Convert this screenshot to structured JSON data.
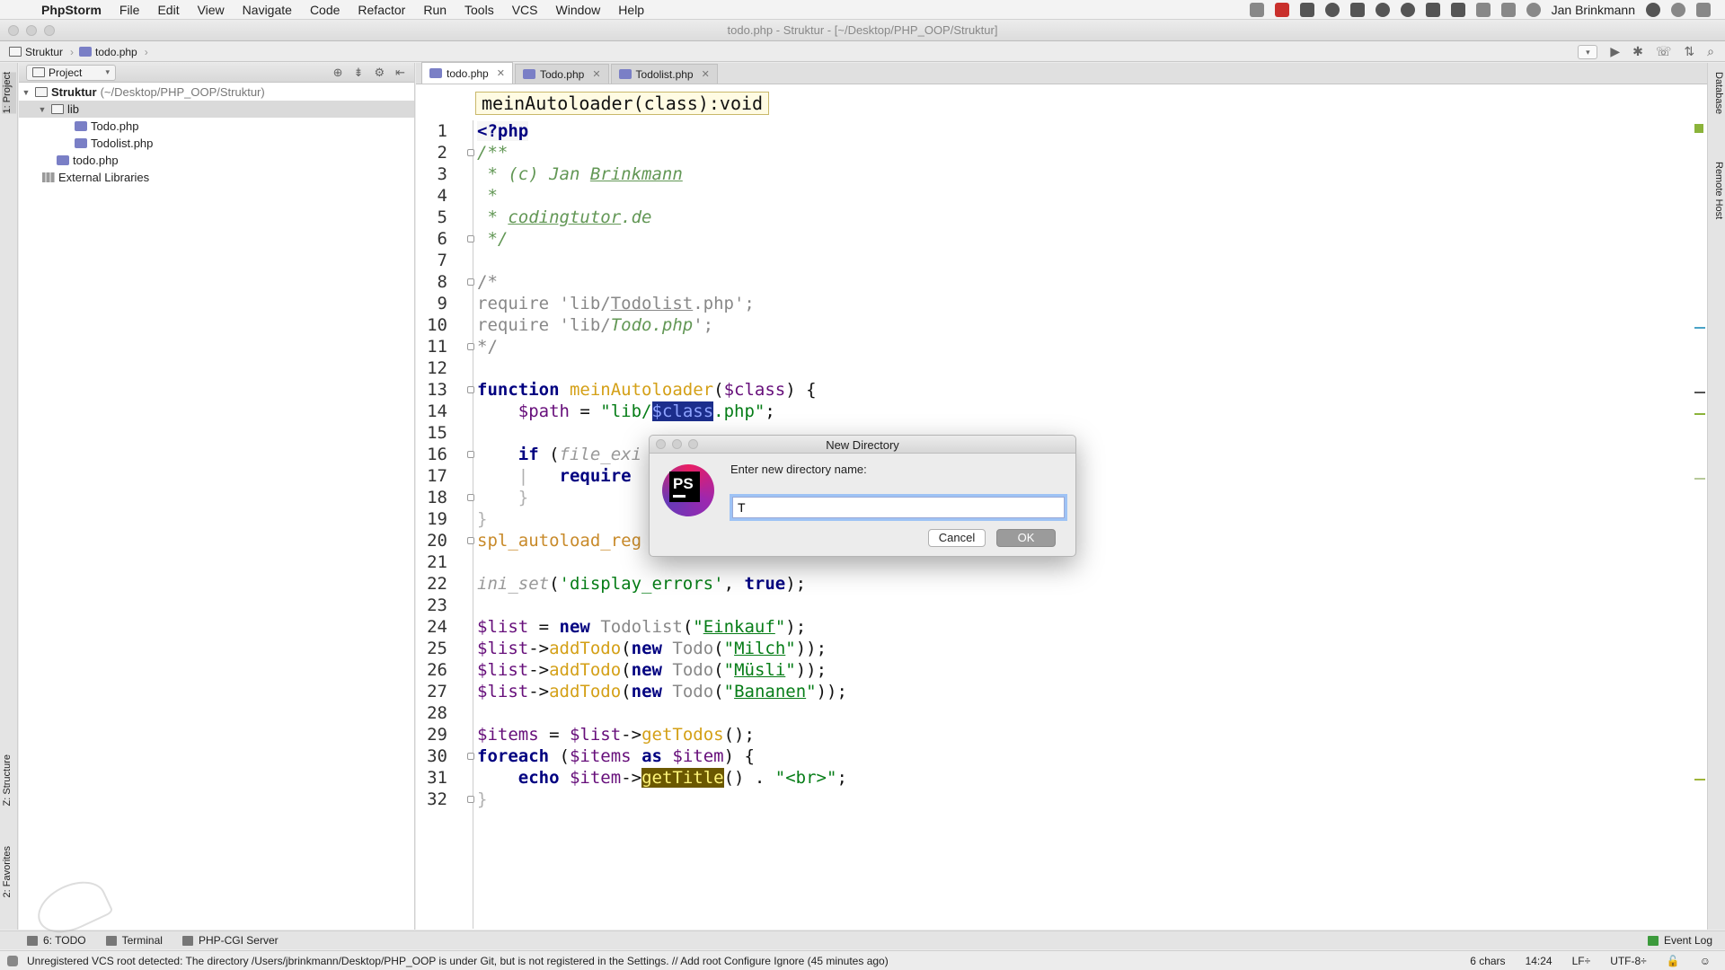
{
  "menubar": {
    "app_name": "PhpStorm",
    "items": [
      "File",
      "Edit",
      "View",
      "Navigate",
      "Code",
      "Refactor",
      "Run",
      "Tools",
      "VCS",
      "Window",
      "Help"
    ],
    "user": "Jan Brinkmann"
  },
  "window": {
    "title": "todo.php - Struktur - [~/Desktop/PHP_OOP/Struktur]"
  },
  "navbar": {
    "crumbs": [
      "Struktur",
      "todo.php"
    ]
  },
  "left_strip": {
    "project_tab": "1: Project",
    "structure_tab": "Z: Structure",
    "favorites_tab": "2: Favorites"
  },
  "right_strip": {
    "database_tab": "Database",
    "remote_host_tab": "Remote Host"
  },
  "project_panel": {
    "selector": "Project",
    "tree": [
      {
        "label": "Struktur",
        "path": "(~/Desktop/PHP_OOP/Struktur)"
      },
      {
        "label": "lib"
      },
      {
        "label": "Todo.php"
      },
      {
        "label": "Todolist.php"
      },
      {
        "label": "todo.php"
      },
      {
        "label": "External Libraries"
      }
    ]
  },
  "editor": {
    "tabs": [
      "todo.php",
      "Todo.php",
      "Todolist.php"
    ],
    "hint": "meinAutoloader(class):void",
    "line_numbers": [
      "1",
      "2",
      "3",
      "4",
      "5",
      "6",
      "7",
      "8",
      "9",
      "10",
      "11",
      "12",
      "13",
      "14",
      "15",
      "16",
      "17",
      "18",
      "19",
      "20",
      "21",
      "22",
      "23",
      "24",
      "25",
      "26",
      "27",
      "28",
      "29",
      "30",
      "31",
      "32"
    ]
  },
  "dialog": {
    "title": "New Directory",
    "logo": "PS",
    "prompt": "Enter new directory name:",
    "value": "T",
    "cancel": "Cancel",
    "ok": "OK"
  },
  "toolwindows": {
    "todo": "6: TODO",
    "terminal": "Terminal",
    "php_cgi": "PHP-CGI Server",
    "event_log": "Event Log"
  },
  "status": {
    "message": "Unregistered VCS root detected: The directory /Users/jbrinkmann/Desktop/PHP_OOP is under Git, but is not registered in the Settings. // Add root  Configure  Ignore (45 minutes ago)",
    "chars": "6 chars",
    "position": "14:24",
    "line_sep": "LF÷",
    "encoding": "UTF-8÷"
  },
  "colors": {
    "comment": "#629755",
    "keyword": "#000080",
    "string": "#067d17",
    "function": "#d4a017",
    "variable": "#660e7a",
    "selection": "#1c2e8c",
    "usage_highlight": "#6b5800"
  }
}
